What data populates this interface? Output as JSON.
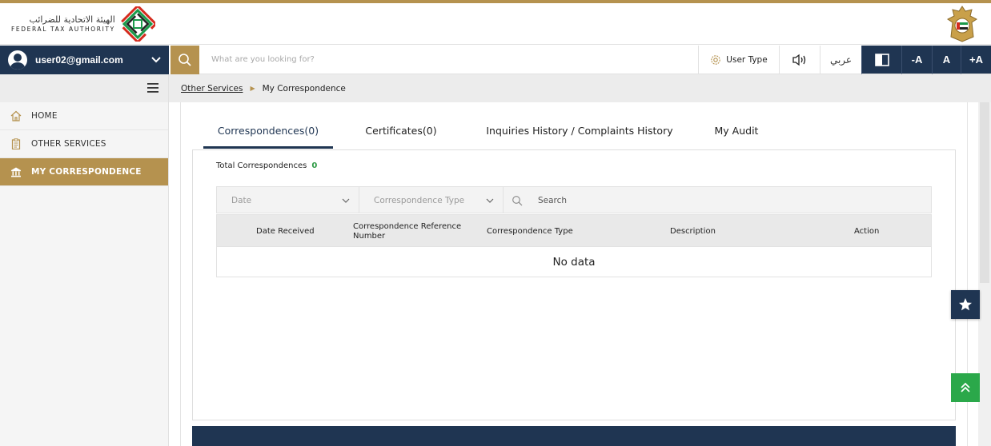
{
  "header": {
    "logo_arabic": "الهيئة الاتحادية للضرائب",
    "logo_english": "FEDERAL TAX AUTHORITY"
  },
  "user": {
    "email": "user02@gmail.com"
  },
  "search": {
    "placeholder": "What are you looking for?"
  },
  "toolbar": {
    "user_type_label": "User Type",
    "language_label": "عربي",
    "font_decrease": "-A",
    "font_normal": "A",
    "font_increase": "+A"
  },
  "sidebar": {
    "items": [
      {
        "label": "HOME",
        "icon": "home-icon"
      },
      {
        "label": "OTHER SERVICES",
        "icon": "clipboard-icon"
      },
      {
        "label": "MY CORRESPONDENCE",
        "icon": "institution-icon",
        "active": true
      }
    ]
  },
  "breadcrumb": {
    "parent": "Other Services",
    "current": "My Correspondence"
  },
  "tabs": [
    {
      "label": "Correspondences(0)",
      "active": true
    },
    {
      "label": "Certificates(0)"
    },
    {
      "label": "Inquiries History / Complaints History"
    },
    {
      "label": "My Audit"
    }
  ],
  "summary": {
    "label": "Total Correspondences",
    "count": "0"
  },
  "filters": {
    "date_placeholder": "Date",
    "type_placeholder": "Correspondence Type",
    "search_placeholder": "Search"
  },
  "table": {
    "columns": [
      "Date Received",
      "Correspondence Reference Number",
      "Correspondence Type",
      "Description",
      "Action"
    ],
    "empty_text": "No data"
  },
  "colors": {
    "navy": "#1f3552",
    "gold": "#b5924f",
    "green": "#2ba84a"
  }
}
